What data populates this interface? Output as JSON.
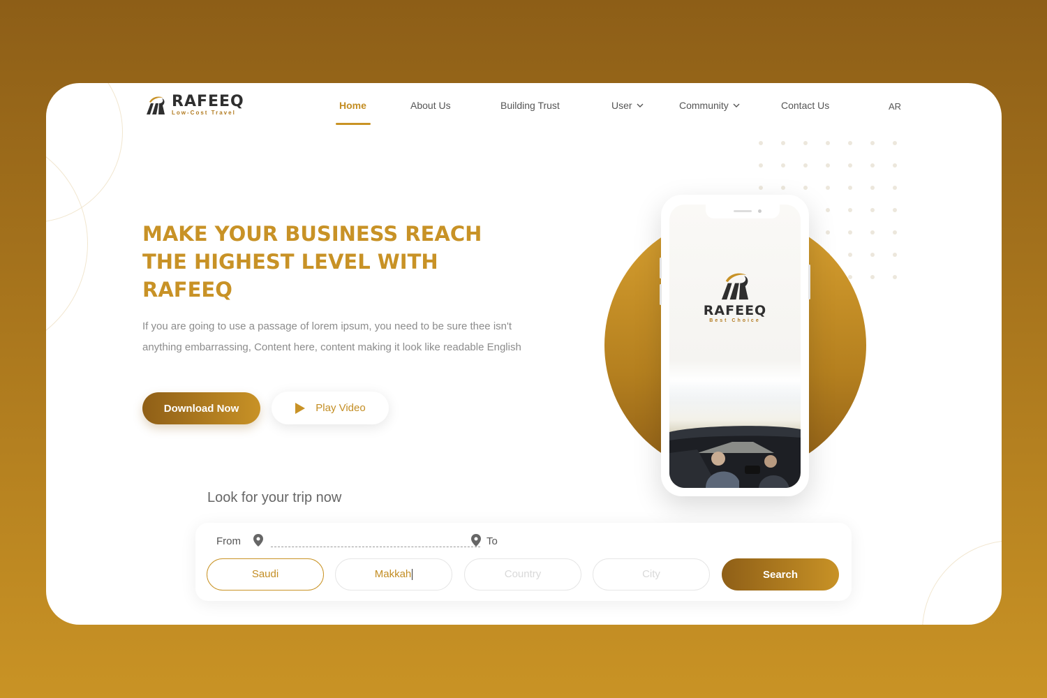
{
  "brand": {
    "name": "RAFEEQ",
    "tagline": "Low-Cost Travel",
    "accent_color": "#c89226",
    "dark_color": "#8f5f17"
  },
  "nav": {
    "items": [
      {
        "label": "Home",
        "active": true
      },
      {
        "label": "About Us"
      },
      {
        "label": "Building Trust"
      },
      {
        "label": "User",
        "has_dropdown": true
      },
      {
        "label": "Community",
        "has_dropdown": true
      },
      {
        "label": "Contact Us"
      }
    ],
    "language": "AR"
  },
  "hero": {
    "title": "MAKE YOUR BUSINESS REACH THE HIGHEST LEVEL WITH RAFEEQ",
    "description": "If you are going to use a passage of lorem ipsum, you need to be sure thee isn't anything embarrassing, Content here, content making it look like readable English",
    "download_label": "Download Now",
    "play_label": "Play Video"
  },
  "phone": {
    "app_name": "RAFEEQ",
    "app_tagline": "Best Choice"
  },
  "search": {
    "heading": "Look for your trip now",
    "from_label": "From",
    "to_label": "To",
    "fields": [
      {
        "value": "Saudi",
        "placeholder": ""
      },
      {
        "value": "Makkah",
        "placeholder": ""
      },
      {
        "value": "",
        "placeholder": "Country"
      },
      {
        "value": "",
        "placeholder": "City"
      }
    ],
    "button_label": "Search"
  }
}
